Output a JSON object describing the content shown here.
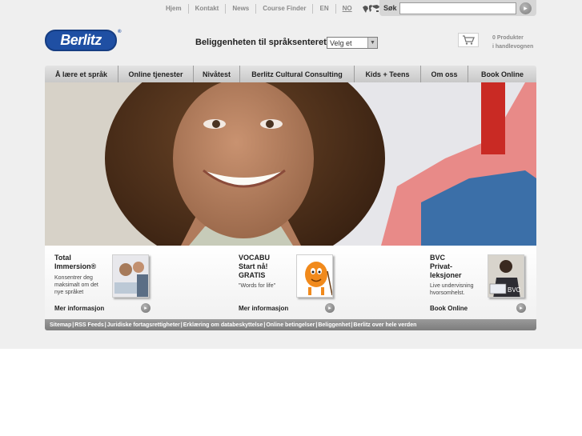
{
  "topnav": {
    "links": [
      "Hjem",
      "Kontakt",
      "News",
      "Course Finder",
      "EN",
      "NO"
    ],
    "globe_icon": "world-map-icon"
  },
  "search": {
    "label": "Søk",
    "value": "",
    "go_icon": "arrow-right-icon"
  },
  "logo": {
    "text": "Berlitz",
    "reg": "®"
  },
  "locator": {
    "label": "Beliggenheten til språksenteret",
    "selected": "Velg et"
  },
  "cart": {
    "icon": "shopping-cart-icon",
    "line1": "0 Produkter",
    "line2": "i handlevognen"
  },
  "menu": [
    "Å lære et språk",
    "Online tjenester",
    "Nivåtest",
    "Berlitz Cultural Consulting",
    "Kids + Teens",
    "Om oss",
    "Book Online"
  ],
  "promos": [
    {
      "title": [
        "Total",
        "Immersion®"
      ],
      "desc": [
        "Konsentrer deg",
        "maksimalt om det",
        "nye språket"
      ],
      "link": "Mer informasjon"
    },
    {
      "title": [
        "VOCABU",
        "Start nå!",
        "GRATIS"
      ],
      "desc": [
        "\"Words for life\""
      ],
      "link": "Mer informasjon"
    },
    {
      "title": [
        "BVC",
        "Privat-",
        "leksjoner"
      ],
      "desc": [
        "Live undervisning",
        "hvorsomhelst."
      ],
      "link": "Book Online",
      "thumb_label": "BVC"
    }
  ],
  "footer": [
    "Sitemap",
    "RSS Feeds",
    "Juridiske fortagsrettigheter",
    "Erklæring om databeskyttelse",
    "Online betingelser",
    "Beliggenhet",
    "Berlitz over hele verden"
  ],
  "colors": {
    "brand": "#1f4fa3",
    "menu_bg": "#d3d3d3",
    "page_bg": "#efefef"
  }
}
